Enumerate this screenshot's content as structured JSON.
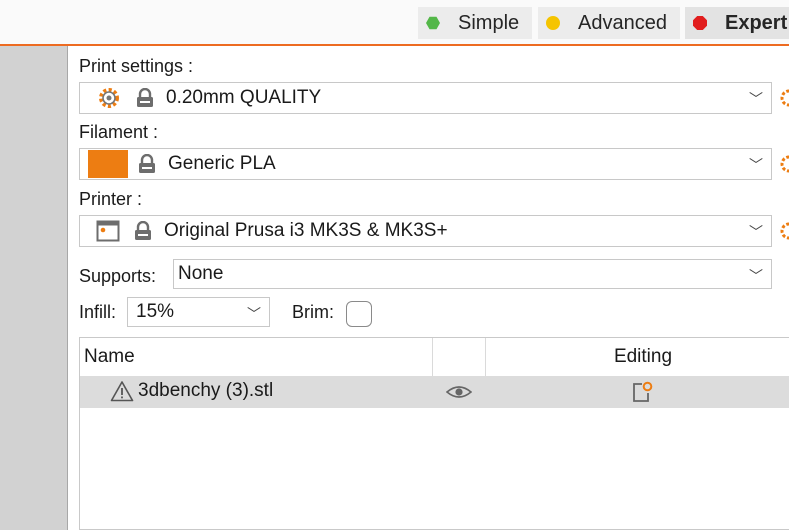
{
  "mode_tabs": [
    {
      "label": "Simple",
      "color": "#53b748",
      "icon": "green-hexagon-icon"
    },
    {
      "label": "Advanced",
      "color": "#f5c400",
      "icon": "yellow-circle-icon"
    },
    {
      "label": "Expert",
      "color": "#e11d1d",
      "icon": "red-octagon-icon"
    }
  ],
  "accent_color": "#ed6b21",
  "print_settings": {
    "label": "Print settings :",
    "value": "0.20mm QUALITY",
    "icon": "gear-icon"
  },
  "filament": {
    "label": "Filament :",
    "value": "Generic PLA",
    "swatch_color": "#ed7d12"
  },
  "printer": {
    "label": "Printer :",
    "value": "Original Prusa i3 MK3S & MK3S+",
    "icon": "printer-icon"
  },
  "supports": {
    "label": "Supports:",
    "value": "None"
  },
  "infill": {
    "label": "Infill:",
    "value": "15%"
  },
  "brim": {
    "label": "Brim:",
    "checked": false
  },
  "object_list": {
    "columns": [
      "Name",
      "",
      "Editing"
    ],
    "rows": [
      {
        "name": "3dbenchy (3).stl",
        "warning_icon": "warning-triangle-icon",
        "visibility_icon": "eye-icon",
        "editing_icon": "edit-settings-icon"
      }
    ]
  }
}
